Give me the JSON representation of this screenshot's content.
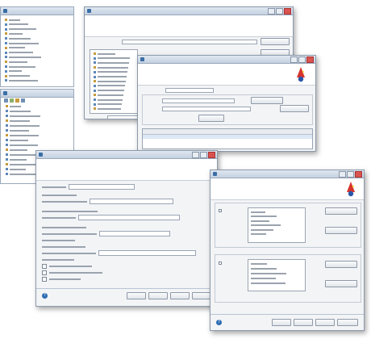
{
  "colors": {
    "titlebar": "#c4d1e1",
    "window_bg": "#f3f4f6",
    "accent": "#3a6ea5",
    "wizard_red": "#d6342c"
  },
  "icons": [
    "wizard-hat-icon",
    "help-icon",
    "checkbox-icon",
    "tree-node-icon",
    "folder-icon"
  ],
  "package_explorer": {
    "title": ""
  },
  "data_source_explorer": {
    "title": ""
  },
  "win_selection": {
    "title": "",
    "heading": "",
    "subheading": "",
    "buttons": {
      "browse": "",
      "add": ""
    }
  },
  "win_rules": {
    "title": "",
    "heading": "",
    "subheading": "",
    "buttons": {
      "action1": "",
      "action2": "",
      "action3": ""
    }
  },
  "win_jdbc": {
    "title": "",
    "heading": "",
    "subheading": "",
    "buttons": {
      "back": "",
      "next": "",
      "finish": "",
      "cancel": ""
    }
  },
  "win_options": {
    "title": "",
    "heading": "",
    "subheading": "",
    "buttons": {
      "add1": "",
      "remove1": "",
      "add2": "",
      "remove2": "",
      "back": "",
      "next": "",
      "finish": "",
      "cancel": ""
    }
  }
}
